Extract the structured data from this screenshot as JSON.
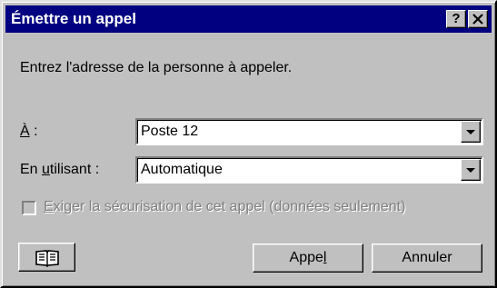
{
  "window": {
    "title": "Émettre un appel",
    "help_label": "?",
    "close_label": "✕"
  },
  "instruction": "Entrez l'adresse de la personne à appeler.",
  "to_field": {
    "label_mnemonic": "À",
    "label_rest": " :",
    "value": "Poste 12"
  },
  "using_field": {
    "label_pre": "En ",
    "label_mnemonic": "u",
    "label_post": "tilisant :",
    "value": "Automatique"
  },
  "secure_checkbox": {
    "label_mnemonic": "E",
    "label_rest": "xiger la sécurisation de cet appel (données seulement)",
    "checked": false,
    "disabled": true
  },
  "buttons": {
    "call_pre": "Appe",
    "call_mnemonic": "l",
    "cancel": "Annuler",
    "address_book_icon": "address-book-icon"
  }
}
